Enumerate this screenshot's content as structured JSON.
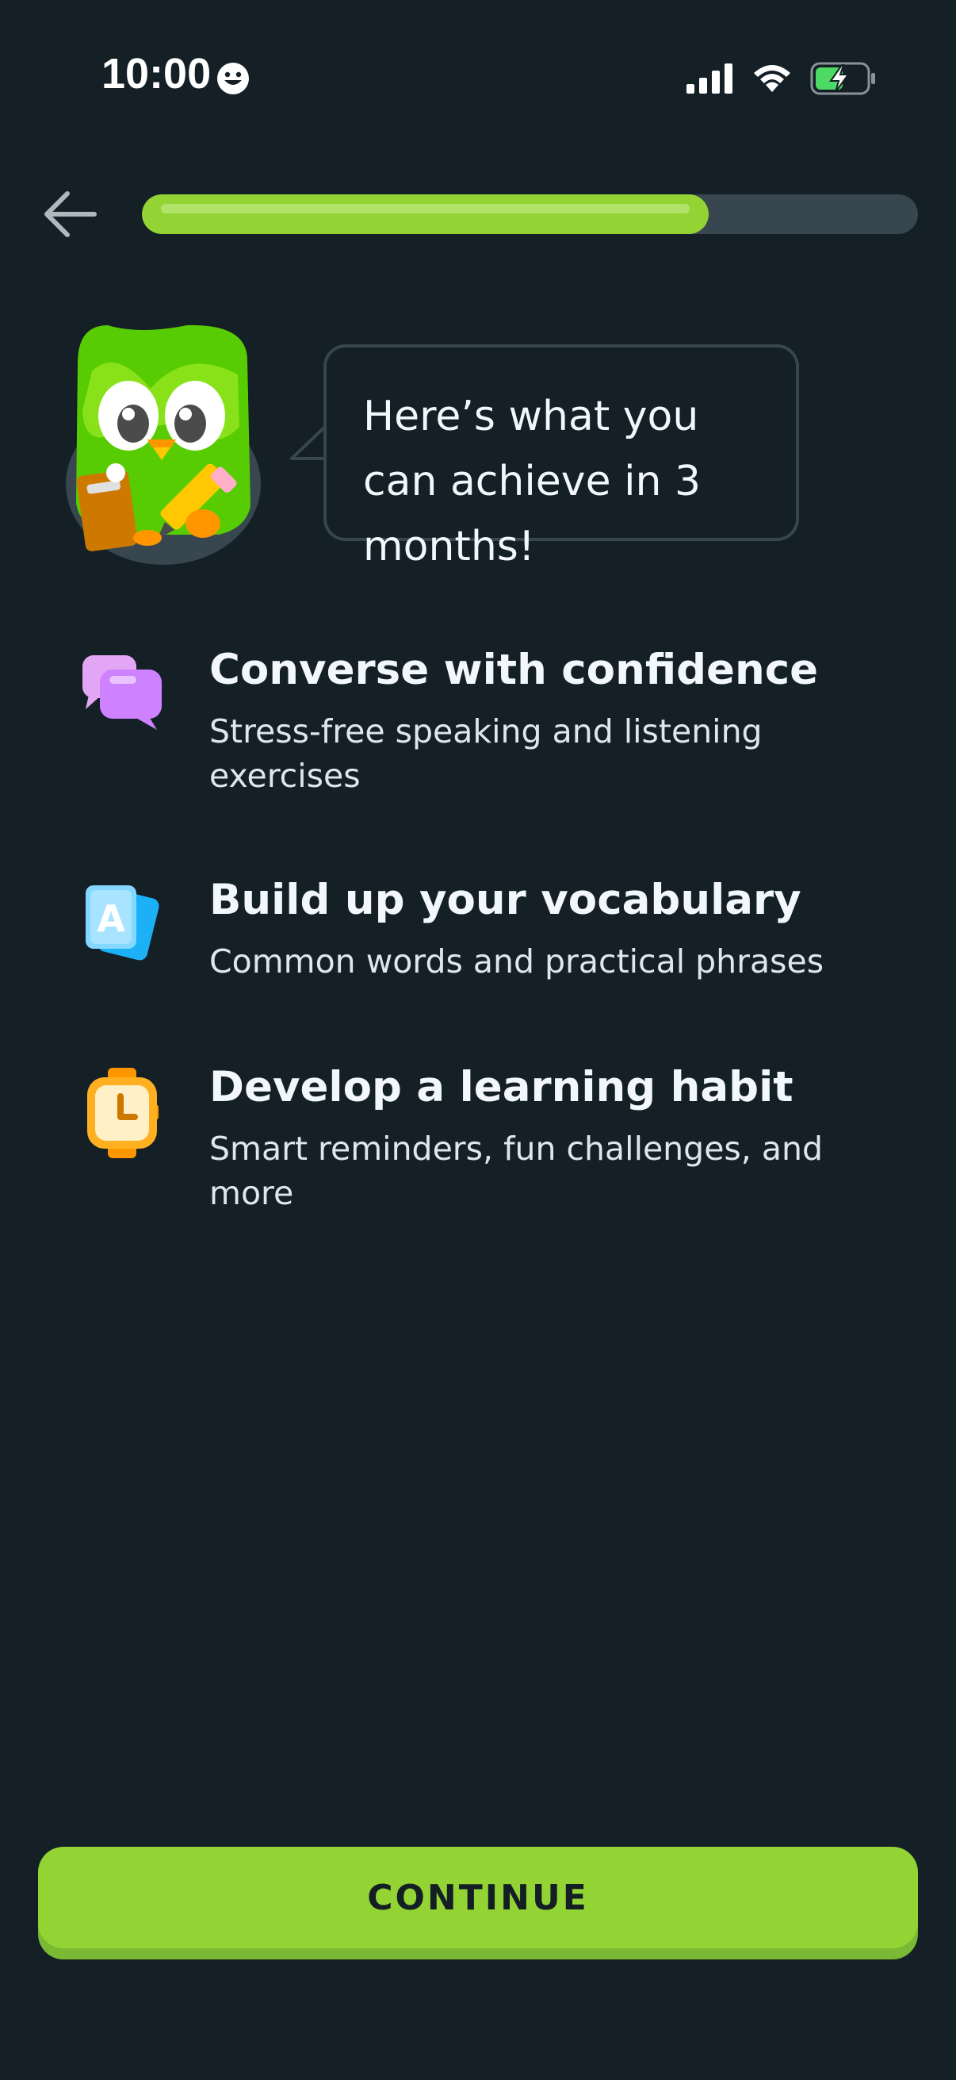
{
  "status_bar": {
    "time": "10:00",
    "face_icon": "smiley-face-icon",
    "signal_icon": "cellular-signal-icon",
    "wifi_icon": "wifi-icon",
    "battery_icon": "battery-charging-icon"
  },
  "nav": {
    "back_icon": "arrow-left-icon",
    "progress": 0.73
  },
  "mascot": {
    "icon": "owl-mascot-icon"
  },
  "speech": {
    "text": "Here’s what you can achieve in 3 months!"
  },
  "benefits": [
    {
      "icon": "chat-bubbles-icon",
      "title": "Converse with confidence",
      "description": "Stress-free speaking and listening exercises"
    },
    {
      "icon": "flashcards-icon",
      "title": "Build up your vocabulary",
      "description": "Common words and practical phrases"
    },
    {
      "icon": "stopwatch-icon",
      "title": "Develop a learning habit",
      "description": "Smart reminders, fun challenges, and more"
    }
  ],
  "continue_button": {
    "label": "CONTINUE"
  },
  "colors": {
    "background": "#141f26",
    "accent_green": "#93d333",
    "track": "#37464f"
  }
}
